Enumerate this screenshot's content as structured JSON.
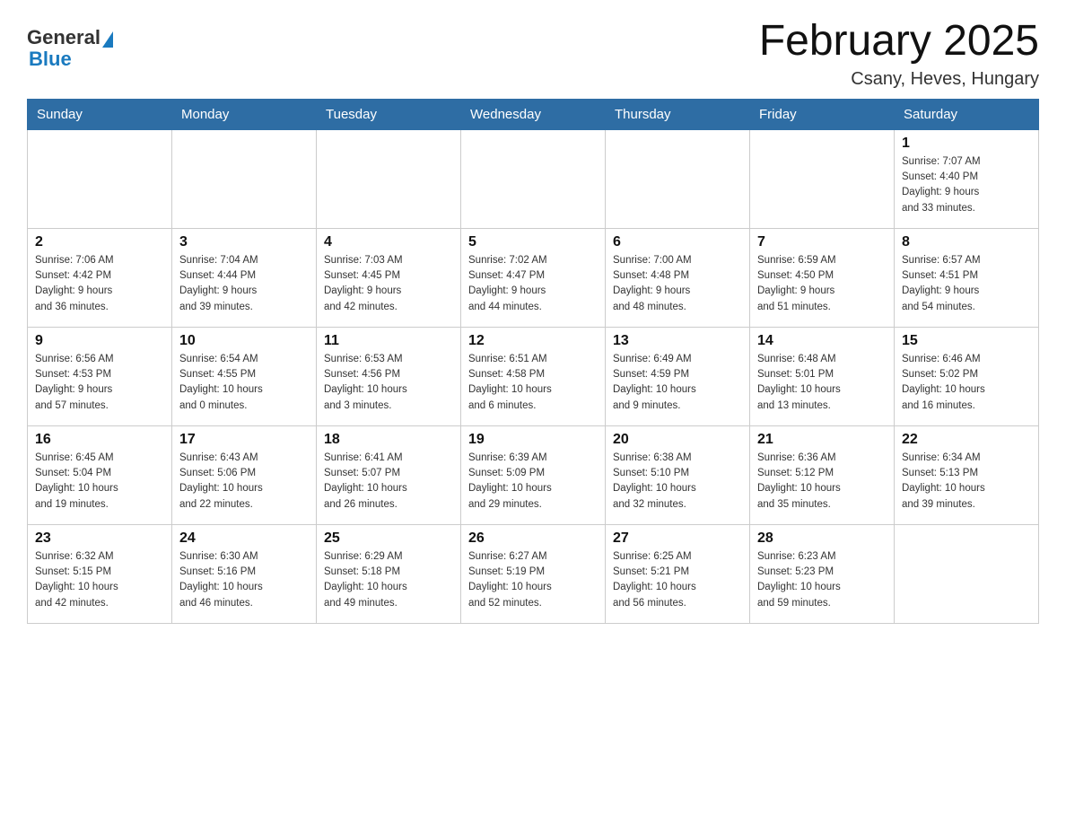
{
  "header": {
    "logo_general": "General",
    "logo_blue": "Blue",
    "month_title": "February 2025",
    "location": "Csany, Heves, Hungary"
  },
  "weekdays": [
    "Sunday",
    "Monday",
    "Tuesday",
    "Wednesday",
    "Thursday",
    "Friday",
    "Saturday"
  ],
  "rows": [
    [
      {
        "day": "",
        "info": ""
      },
      {
        "day": "",
        "info": ""
      },
      {
        "day": "",
        "info": ""
      },
      {
        "day": "",
        "info": ""
      },
      {
        "day": "",
        "info": ""
      },
      {
        "day": "",
        "info": ""
      },
      {
        "day": "1",
        "info": "Sunrise: 7:07 AM\nSunset: 4:40 PM\nDaylight: 9 hours\nand 33 minutes."
      }
    ],
    [
      {
        "day": "2",
        "info": "Sunrise: 7:06 AM\nSunset: 4:42 PM\nDaylight: 9 hours\nand 36 minutes."
      },
      {
        "day": "3",
        "info": "Sunrise: 7:04 AM\nSunset: 4:44 PM\nDaylight: 9 hours\nand 39 minutes."
      },
      {
        "day": "4",
        "info": "Sunrise: 7:03 AM\nSunset: 4:45 PM\nDaylight: 9 hours\nand 42 minutes."
      },
      {
        "day": "5",
        "info": "Sunrise: 7:02 AM\nSunset: 4:47 PM\nDaylight: 9 hours\nand 44 minutes."
      },
      {
        "day": "6",
        "info": "Sunrise: 7:00 AM\nSunset: 4:48 PM\nDaylight: 9 hours\nand 48 minutes."
      },
      {
        "day": "7",
        "info": "Sunrise: 6:59 AM\nSunset: 4:50 PM\nDaylight: 9 hours\nand 51 minutes."
      },
      {
        "day": "8",
        "info": "Sunrise: 6:57 AM\nSunset: 4:51 PM\nDaylight: 9 hours\nand 54 minutes."
      }
    ],
    [
      {
        "day": "9",
        "info": "Sunrise: 6:56 AM\nSunset: 4:53 PM\nDaylight: 9 hours\nand 57 minutes."
      },
      {
        "day": "10",
        "info": "Sunrise: 6:54 AM\nSunset: 4:55 PM\nDaylight: 10 hours\nand 0 minutes."
      },
      {
        "day": "11",
        "info": "Sunrise: 6:53 AM\nSunset: 4:56 PM\nDaylight: 10 hours\nand 3 minutes."
      },
      {
        "day": "12",
        "info": "Sunrise: 6:51 AM\nSunset: 4:58 PM\nDaylight: 10 hours\nand 6 minutes."
      },
      {
        "day": "13",
        "info": "Sunrise: 6:49 AM\nSunset: 4:59 PM\nDaylight: 10 hours\nand 9 minutes."
      },
      {
        "day": "14",
        "info": "Sunrise: 6:48 AM\nSunset: 5:01 PM\nDaylight: 10 hours\nand 13 minutes."
      },
      {
        "day": "15",
        "info": "Sunrise: 6:46 AM\nSunset: 5:02 PM\nDaylight: 10 hours\nand 16 minutes."
      }
    ],
    [
      {
        "day": "16",
        "info": "Sunrise: 6:45 AM\nSunset: 5:04 PM\nDaylight: 10 hours\nand 19 minutes."
      },
      {
        "day": "17",
        "info": "Sunrise: 6:43 AM\nSunset: 5:06 PM\nDaylight: 10 hours\nand 22 minutes."
      },
      {
        "day": "18",
        "info": "Sunrise: 6:41 AM\nSunset: 5:07 PM\nDaylight: 10 hours\nand 26 minutes."
      },
      {
        "day": "19",
        "info": "Sunrise: 6:39 AM\nSunset: 5:09 PM\nDaylight: 10 hours\nand 29 minutes."
      },
      {
        "day": "20",
        "info": "Sunrise: 6:38 AM\nSunset: 5:10 PM\nDaylight: 10 hours\nand 32 minutes."
      },
      {
        "day": "21",
        "info": "Sunrise: 6:36 AM\nSunset: 5:12 PM\nDaylight: 10 hours\nand 35 minutes."
      },
      {
        "day": "22",
        "info": "Sunrise: 6:34 AM\nSunset: 5:13 PM\nDaylight: 10 hours\nand 39 minutes."
      }
    ],
    [
      {
        "day": "23",
        "info": "Sunrise: 6:32 AM\nSunset: 5:15 PM\nDaylight: 10 hours\nand 42 minutes."
      },
      {
        "day": "24",
        "info": "Sunrise: 6:30 AM\nSunset: 5:16 PM\nDaylight: 10 hours\nand 46 minutes."
      },
      {
        "day": "25",
        "info": "Sunrise: 6:29 AM\nSunset: 5:18 PM\nDaylight: 10 hours\nand 49 minutes."
      },
      {
        "day": "26",
        "info": "Sunrise: 6:27 AM\nSunset: 5:19 PM\nDaylight: 10 hours\nand 52 minutes."
      },
      {
        "day": "27",
        "info": "Sunrise: 6:25 AM\nSunset: 5:21 PM\nDaylight: 10 hours\nand 56 minutes."
      },
      {
        "day": "28",
        "info": "Sunrise: 6:23 AM\nSunset: 5:23 PM\nDaylight: 10 hours\nand 59 minutes."
      },
      {
        "day": "",
        "info": ""
      }
    ]
  ]
}
